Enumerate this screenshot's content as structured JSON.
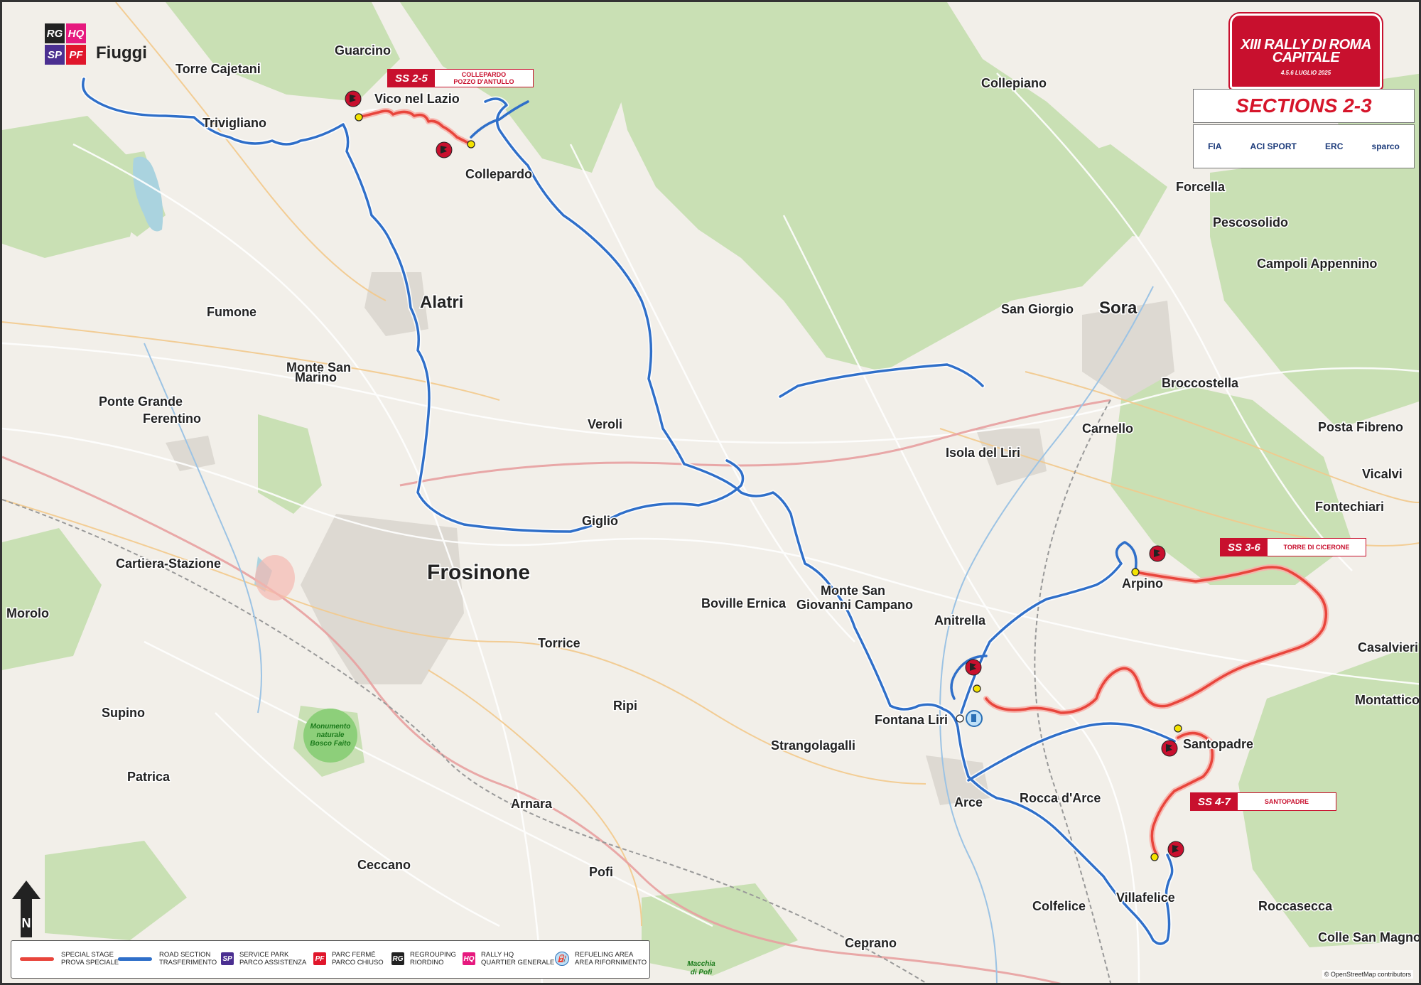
{
  "header": {
    "rally_title_line1": "XIII RALLY DI ROMA",
    "rally_title_line2": "CAPITALE",
    "rally_dates": "4.5.6 LUGLIO 2025",
    "sections_title": "SECTIONS 2-3",
    "sponsors": [
      "FIA",
      "ACI SPORT",
      "ERC",
      "sparco"
    ]
  },
  "start_location": {
    "badges": [
      "RG",
      "HQ",
      "SP",
      "PF"
    ],
    "name": "Fiuggi"
  },
  "stages": [
    {
      "number": "SS 2-5",
      "name_line1": "COLLEPARDO",
      "name_line2": "POZZO D'ANTULLO"
    },
    {
      "number": "SS 3-6",
      "name_line1": "TORRE DI CICERONE",
      "name_line2": ""
    },
    {
      "number": "SS 4-7",
      "name_line1": "SANTOPADRE",
      "name_line2": ""
    }
  ],
  "places": {
    "major": [
      "Frosinone"
    ],
    "medium": [
      "Alatri",
      "Sora"
    ],
    "towns": [
      "Guarcino",
      "Torre Cajetani",
      "Vico nel Lazio",
      "Trivigliano",
      "Collepardo",
      "Collepiano",
      "Forcella",
      "Pescosolido",
      "Campoli Appennino",
      "San Giorgio",
      "Fumone",
      "Monte San",
      "Marino",
      "Ponte Grande",
      "Ferentino",
      "Veroli",
      "Broccostella",
      "Carnello",
      "Posta Fibreno",
      "Isola del Liri",
      "Vicalvi",
      "Fontechiari",
      "Giglio",
      "Cartiera-Stazione",
      "Morolo",
      "Arpino",
      "Monte San",
      "Giovanni Campano",
      "Boville Ernica",
      "Anitrella",
      "Torrice",
      "Casalvieri",
      "Ripi",
      "Montattico",
      "Fontana Liri",
      "Supino",
      "Strangolagalli",
      "Santopadre",
      "Patrica",
      "Arce",
      "Rocca d'Arce",
      "Arnara",
      "Ceccano",
      "Pofi",
      "Villafelice",
      "Colfelice",
      "Roccasecca",
      "Colle San Magno",
      "Ceprano"
    ],
    "park": [
      "Monumento",
      "naturale",
      "Bosco Faito"
    ],
    "macchia": [
      "Macchia",
      "di Pofi"
    ]
  },
  "legend": {
    "items": [
      {
        "type": "line",
        "color": "#e8453c",
        "line1": "SPECIAL STAGE",
        "line2": "PROVA SPECIALE"
      },
      {
        "type": "line",
        "color": "#2f6fc9",
        "line1": "ROAD SECTION",
        "line2": "TRASFERIMENTO"
      },
      {
        "type": "badge",
        "badge": "SP",
        "color": "#4b2f91",
        "line1": "SERVICE PARK",
        "line2": "PARCO ASSISTENZA"
      },
      {
        "type": "badge",
        "badge": "PF",
        "color": "#e0162b",
        "line1": "PARC FERMÉ",
        "line2": "PARCO CHIUSO"
      },
      {
        "type": "badge",
        "badge": "RG",
        "color": "#222222",
        "line1": "REGROUPING",
        "line2": "RIORDINO"
      },
      {
        "type": "badge",
        "badge": "HQ",
        "color": "#e6197e",
        "line1": "RALLY HQ",
        "line2": "QUARTIER GENERALE"
      },
      {
        "type": "icon",
        "badge": "⛽",
        "color": "#2a6fb5",
        "line1": "REFUELING AREA",
        "line2": "AREA RIFORNIMENTO"
      }
    ]
  },
  "copyright": "© OpenStreetMap contributors",
  "north_label": "N",
  "colors": {
    "special_stage": "#e8453c",
    "road_section": "#2f6fc9",
    "stage_marker": "#c8102e",
    "time_control": "#f4e300",
    "forest": "#c9e0b4",
    "land": "#f2efe9"
  }
}
